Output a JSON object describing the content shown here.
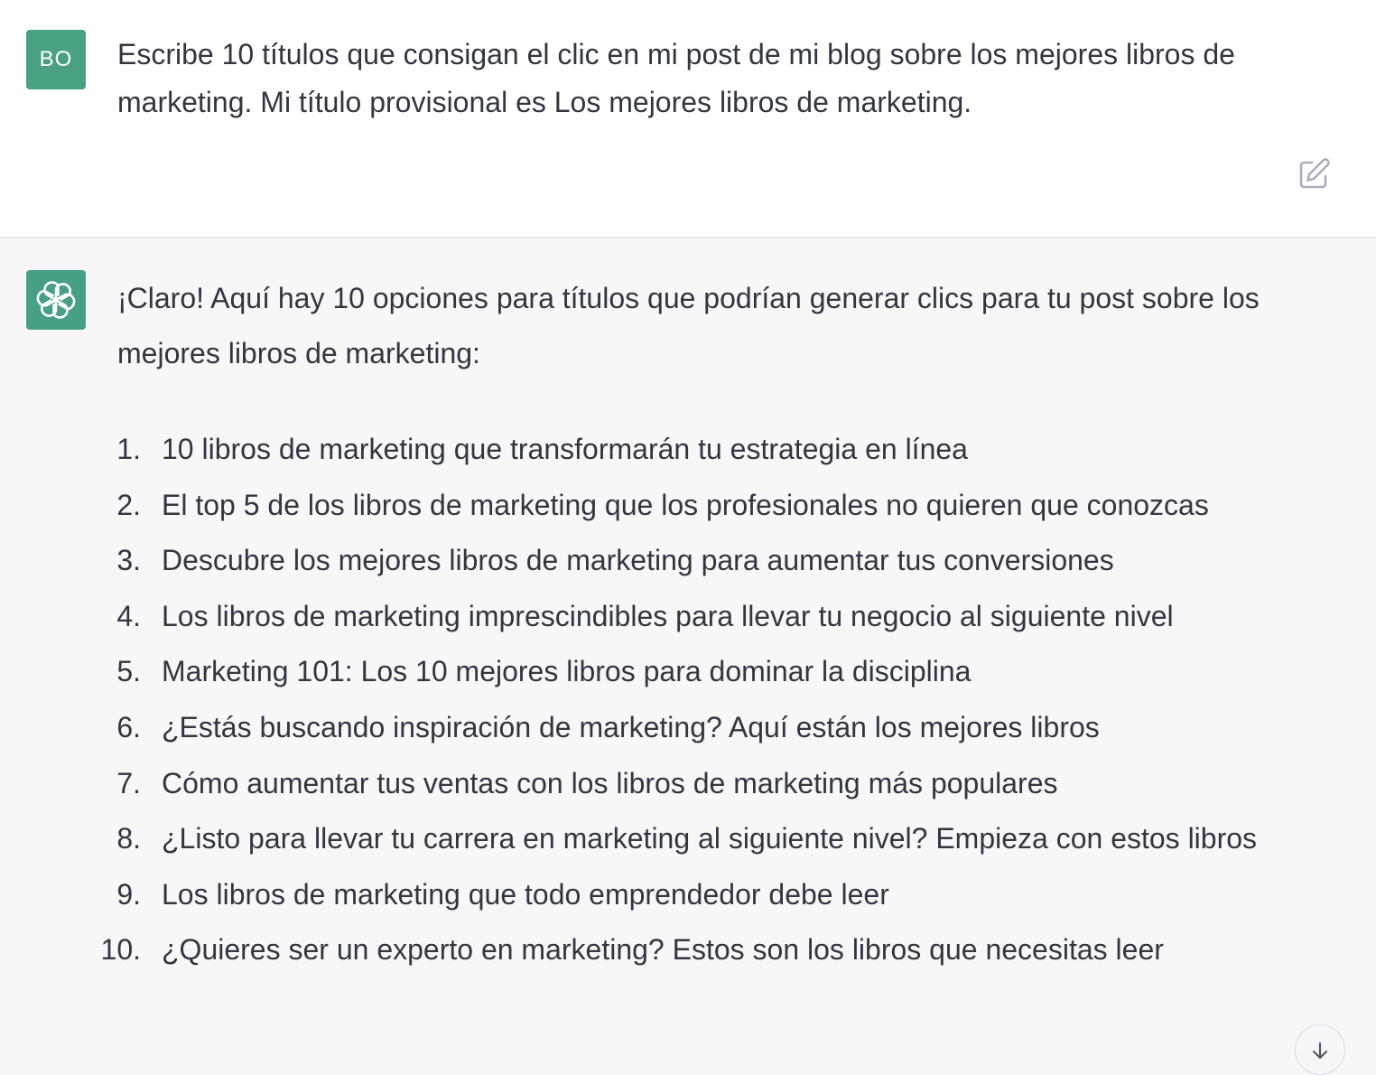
{
  "user_message": {
    "avatar_initials": "BO",
    "avatar_color": "#4aa182",
    "text": "Escribe 10 títulos que consigan el clic en mi post de mi blog sobre los mejores libros de marketing. Mi título provisional es Los mejores libros de marketing.",
    "edit_icon": "edit-icon"
  },
  "assistant_message": {
    "avatar_icon": "openai-logo-icon",
    "avatar_color": "#47a085",
    "intro": "¡Claro! Aquí hay 10 opciones para títulos que podrían generar clics para tu post sobre los mejores libros de marketing:",
    "items": [
      {
        "num": "1.",
        "text": "10 libros de marketing que transformarán tu estrategia en línea"
      },
      {
        "num": "2.",
        "text": "El top 5 de los libros de marketing que los profesionales no quieren que conozcas"
      },
      {
        "num": "3.",
        "text": "Descubre los mejores libros de marketing para aumentar tus conversiones"
      },
      {
        "num": "4.",
        "text": "Los libros de marketing imprescindibles para llevar tu negocio al siguiente nivel"
      },
      {
        "num": "5.",
        "text": "Marketing 101: Los 10 mejores libros para dominar la disciplina"
      },
      {
        "num": "6.",
        "text": "¿Estás buscando inspiración de marketing? Aquí están los mejores libros"
      },
      {
        "num": "7.",
        "text": "Cómo aumentar tus ventas con los libros de marketing más populares"
      },
      {
        "num": "8.",
        "text": "¿Listo para llevar tu carrera en marketing al siguiente nivel? Empieza con estos libros"
      },
      {
        "num": "9.",
        "text": "Los libros de marketing que todo emprendedor debe leer"
      },
      {
        "num": "10.",
        "text": "¿Quieres ser un experto en marketing? Estos son los libros que necesitas leer"
      }
    ]
  },
  "scroll_button_icon": "arrow-down-icon"
}
